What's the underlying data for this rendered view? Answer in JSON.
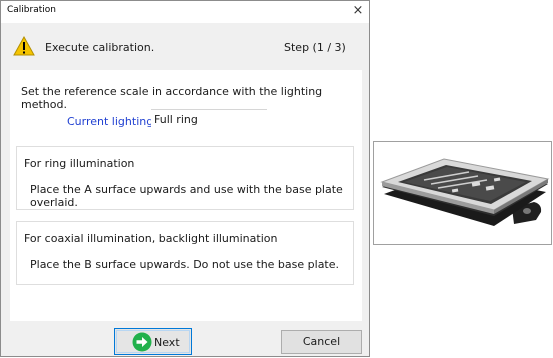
{
  "window": {
    "title": "Calibration",
    "close_glyph": "×"
  },
  "header": {
    "message": "Execute calibration.",
    "step": "Step (1 / 3)",
    "icon": "warning-icon"
  },
  "content": {
    "instruction": "Set the reference scale in accordance with the lighting method.",
    "lighting_label": "Current lighting:",
    "lighting_value": "Full ring",
    "ring_group": {
      "title": "For ring illumination",
      "description": "Place the A surface upwards and use with the base plate overlaid."
    },
    "coax_group": {
      "title": "For coaxial illumination, backlight illumination",
      "description": "Place the B surface upwards. Do not use the base plate."
    }
  },
  "buttons": {
    "next_label": "Next",
    "next_icon": "arrow-right-icon",
    "cancel_label": "Cancel"
  },
  "colors": {
    "accent": "#0078d7",
    "label_blue": "#1f3fd1",
    "next_icon_green": "#22b14c",
    "warning_yellow": "#f5c400"
  }
}
